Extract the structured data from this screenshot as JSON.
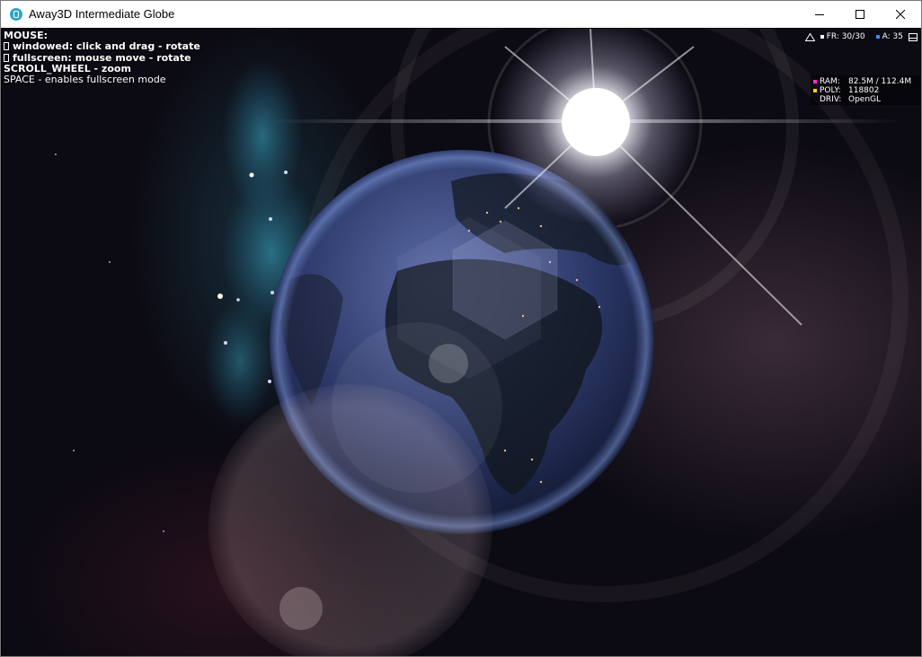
{
  "window": {
    "title": "Away3D Intermediate Globe"
  },
  "help": {
    "heading": "MOUSE:",
    "lines": [
      "windowed: click and drag - rotate",
      "fullscreen: mouse move - rotate",
      "SCROLL_WHEEL - zoom",
      "SPACE - enables fullscreen mode"
    ]
  },
  "stats": {
    "fr_label": "FR:",
    "fr_value": "30/30",
    "a_label": "A:",
    "a_value": "35",
    "ram_label": "RAM:",
    "ram_value": "82.5M / 112.4M",
    "poly_label": "POLY:",
    "poly_value": "118802",
    "driv_label": "DRIV:",
    "driv_value": "OpenGL"
  },
  "colors": {
    "fr_marker": "#ffffff",
    "a_marker": "#3d8bff",
    "ram_marker": "#ff2bd6",
    "poly_marker": "#ffd400",
    "app_icon": "#2aa7c9"
  },
  "icons": {
    "app": "away3d-logo-icon",
    "minimize": "minimize-icon",
    "maximize": "maximize-icon",
    "close": "close-icon",
    "stats_graph": "triangle-graph-icon",
    "stats_expand": "window-icon"
  }
}
